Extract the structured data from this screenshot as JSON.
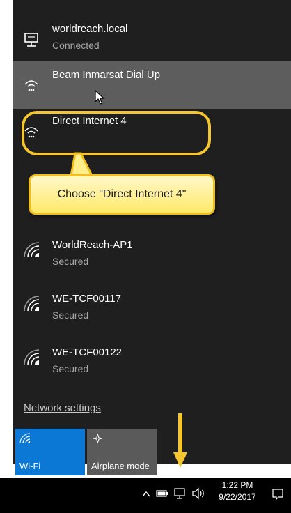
{
  "networks": {
    "worldreach_local": {
      "name": "worldreach.local",
      "status": "Connected"
    },
    "beam": {
      "name": "Beam Inmarsat Dial Up"
    },
    "direct": {
      "name": "Direct Internet 4"
    },
    "wifi1": {
      "name": "WorldReach-AP1",
      "status": "Secured"
    },
    "wifi2": {
      "name": "WE-TCF00117",
      "status": "Secured"
    },
    "wifi3": {
      "name": "WE-TCF00122",
      "status": "Secured"
    }
  },
  "callout": {
    "text": "Choose \"Direct Internet 4\""
  },
  "footer": {
    "network_settings": "Network settings"
  },
  "tiles": {
    "wifi": {
      "label": "Wi-Fi",
      "active": true
    },
    "airplane": {
      "label": "Airplane mode",
      "active": false
    }
  },
  "taskbar": {
    "time": "1:22 PM",
    "date": "9/22/2017",
    "icons": [
      "chevron-up-icon",
      "battery-icon",
      "network-icon",
      "volume-icon",
      "action-center-icon"
    ]
  },
  "colors": {
    "flyout_bg": "#1f1f1f",
    "hover_bg": "#5d5d5d",
    "accent": "#0a78d4",
    "callout": "#f6c630"
  }
}
